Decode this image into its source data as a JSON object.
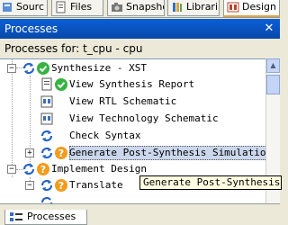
{
  "top_tabs": [
    {
      "label": "Sourc",
      "icon": "sources-icon"
    },
    {
      "label": "Files",
      "icon": "files-icon"
    },
    {
      "label": "Snapsho",
      "icon": "snapshots-icon"
    },
    {
      "label": "Librari",
      "icon": "libraries-icon"
    },
    {
      "label": "Design",
      "icon": "design-icon"
    }
  ],
  "panel": {
    "title": "Processes",
    "close_glyph": "✕",
    "subtitle": "Processes for: t_cpu - cpu"
  },
  "tree": {
    "items": [
      {
        "label": "Synthesize - XST",
        "status": "ok"
      },
      {
        "label": "View Synthesis Report",
        "status": "ok"
      },
      {
        "label": "View RTL Schematic",
        "status": "none"
      },
      {
        "label": "View Technology Schematic",
        "status": "none"
      },
      {
        "label": "Check Syntax",
        "status": "none"
      },
      {
        "label": "Generate Post-Synthesis Simulation M",
        "status": "warn"
      },
      {
        "label": "Implement Design",
        "status": "warn"
      },
      {
        "label": "Translate",
        "status": "warn"
      }
    ]
  },
  "tooltip": "Generate Post-Synthesis Si",
  "bottom_tab": "Processes",
  "colors": {
    "title_bar": "#0a5fd8",
    "ok": "#36b340",
    "warn": "#f59a1b",
    "selection": "#cbd7ec"
  }
}
